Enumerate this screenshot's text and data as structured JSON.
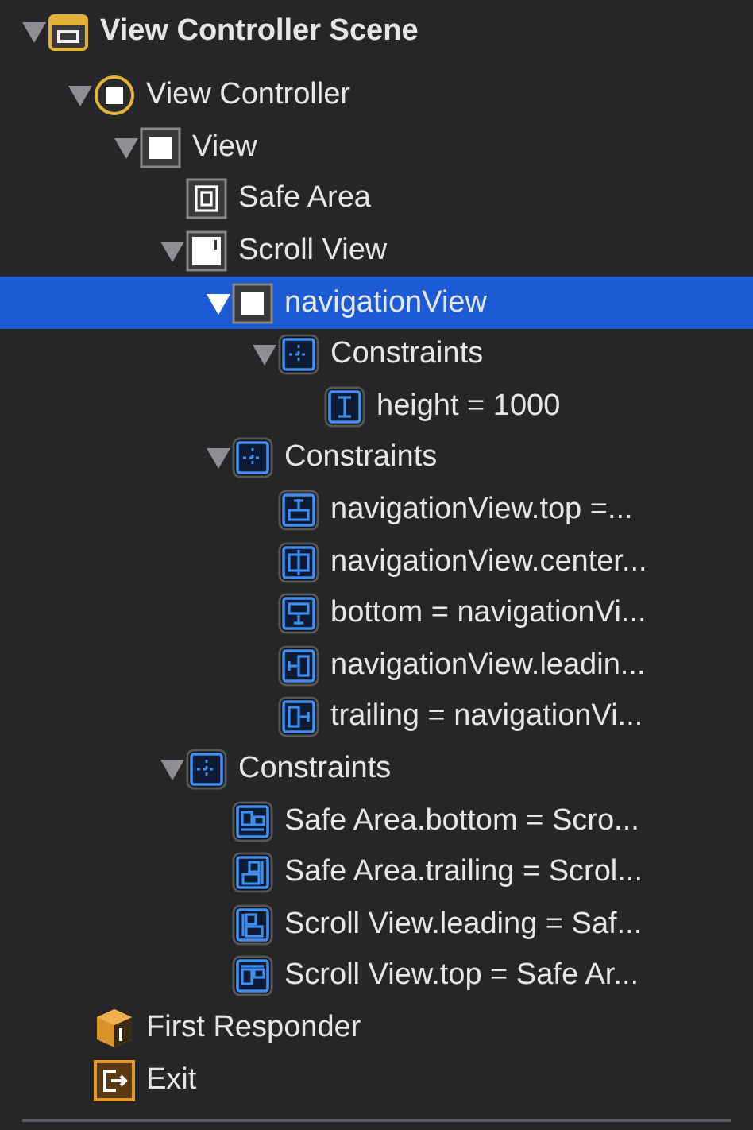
{
  "outline": [
    {
      "label": "View Controller Scene",
      "kind": "scene",
      "expanded": true,
      "selected": false,
      "children": [
        {
          "label": "View Controller",
          "kind": "view-controller",
          "expanded": true,
          "selected": false,
          "children": [
            {
              "label": "View",
              "kind": "view",
              "expanded": true,
              "selected": false,
              "children": [
                {
                  "label": "Safe Area",
                  "kind": "safe-area",
                  "selected": false
                },
                {
                  "label": "Scroll View",
                  "kind": "scroll-view",
                  "expanded": true,
                  "selected": false,
                  "children": [
                    {
                      "label": "navigationView",
                      "kind": "view",
                      "expanded": true,
                      "selected": true,
                      "children": [
                        {
                          "label": "Constraints",
                          "kind": "constraints",
                          "expanded": true,
                          "selected": false,
                          "children": [
                            {
                              "label": "height = 1000",
                              "kind": "constraint-height",
                              "selected": false
                            }
                          ]
                        }
                      ]
                    },
                    {
                      "label": "Constraints",
                      "kind": "constraints",
                      "expanded": true,
                      "selected": false,
                      "children": [
                        {
                          "label": "navigationView.top =...",
                          "kind": "constraint-top",
                          "selected": false
                        },
                        {
                          "label": "navigationView.center...",
                          "kind": "constraint-center",
                          "selected": false
                        },
                        {
                          "label": "bottom = navigationVi...",
                          "kind": "constraint-bottom",
                          "selected": false
                        },
                        {
                          "label": "navigationView.leadin...",
                          "kind": "constraint-leading",
                          "selected": false
                        },
                        {
                          "label": "trailing = navigationVi...",
                          "kind": "constraint-trailing",
                          "selected": false
                        }
                      ]
                    }
                  ]
                },
                {
                  "label": "Constraints",
                  "kind": "constraints",
                  "expanded": true,
                  "selected": false,
                  "children": [
                    {
                      "label": "Safe Area.bottom = Scro...",
                      "kind": "align-bottom",
                      "selected": false
                    },
                    {
                      "label": "Safe Area.trailing = Scrol...",
                      "kind": "align-trailing",
                      "selected": false
                    },
                    {
                      "label": "Scroll View.leading = Saf...",
                      "kind": "align-leading",
                      "selected": false
                    },
                    {
                      "label": "Scroll View.top = Safe Ar...",
                      "kind": "align-top",
                      "selected": false
                    }
                  ]
                }
              ]
            }
          ]
        },
        {
          "label": "First Responder",
          "kind": "first-responder",
          "selected": false
        },
        {
          "label": "Exit",
          "kind": "exit",
          "selected": false
        }
      ]
    }
  ]
}
